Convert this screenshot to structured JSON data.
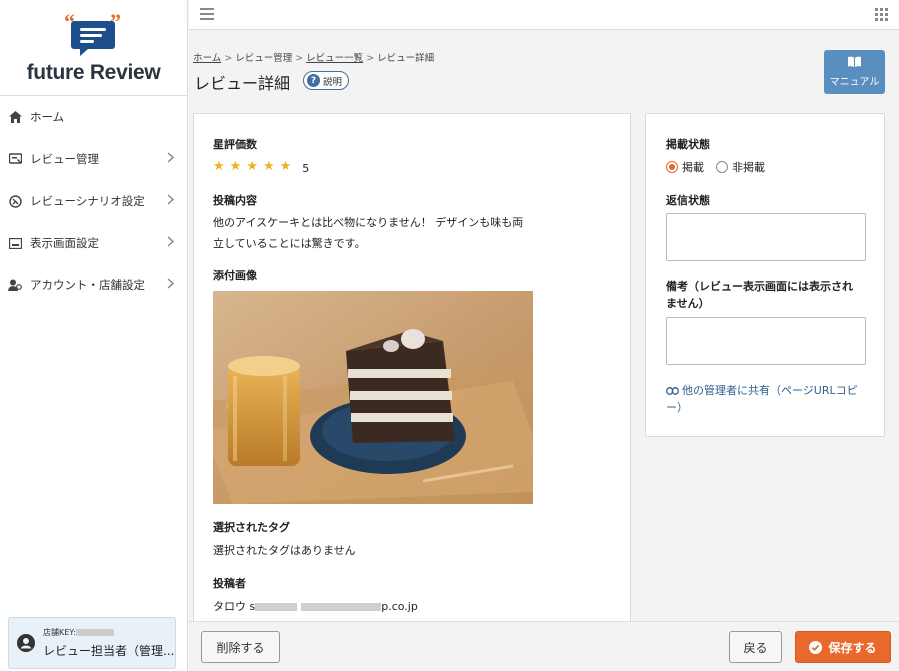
{
  "app": {
    "logo_text": "future Review"
  },
  "sidebar": {
    "items": [
      {
        "label": "ホーム",
        "icon": "home-icon",
        "chevron": false
      },
      {
        "label": "レビュー管理",
        "icon": "review-icon",
        "chevron": true
      },
      {
        "label": "レビューシナリオ設定",
        "icon": "scenario-icon",
        "chevron": true
      },
      {
        "label": "表示画面設定",
        "icon": "display-icon",
        "chevron": true
      },
      {
        "label": "アカウント・店舗設定",
        "icon": "account-icon",
        "chevron": true
      }
    ],
    "user": {
      "store_key_label": "店舗KEY:",
      "name": "レビュー担当者（管理..."
    }
  },
  "breadcrumb": {
    "home": "ホーム",
    "review_mgmt": "レビュー管理",
    "review_list": "レビュー一覧",
    "current": "レビュー詳細",
    "separator": ">"
  },
  "page": {
    "title": "レビュー詳細",
    "help_label": "説明",
    "manual_label": "マニュアル"
  },
  "review": {
    "rating_label": "星評価数",
    "rating_value": 5,
    "rating_text": "5",
    "content_label": "投稿内容",
    "content_line1": "他のアイスケーキとは比べ物になりません！ デザインも味も両",
    "content_line2": "立していることには驚きです。",
    "image_label": "添付画像",
    "tags_label": "選択されたタグ",
    "tags_value": "選択されたタグはありません",
    "poster_label": "投稿者",
    "poster_name": "タロウ s",
    "poster_domain_tail": "p.co.jp"
  },
  "status": {
    "publish_label": "掲載状態",
    "publish_options": [
      "掲載",
      "非掲載"
    ],
    "publish_selected": "掲載",
    "reply_label": "返信状態",
    "note_label_line1": "備考（レビュー表示画面には表示され",
    "note_label_line2": "ません）",
    "share_line1": "他の管理者に共有（ページURLコピ",
    "share_line2": "ー）"
  },
  "actions": {
    "delete": "削除する",
    "back": "戻る",
    "save": "保存する"
  },
  "colors": {
    "accent": "#e8692c",
    "primary": "#5a8ec0",
    "star": "#f2b01e",
    "link": "#2f5f8f"
  }
}
